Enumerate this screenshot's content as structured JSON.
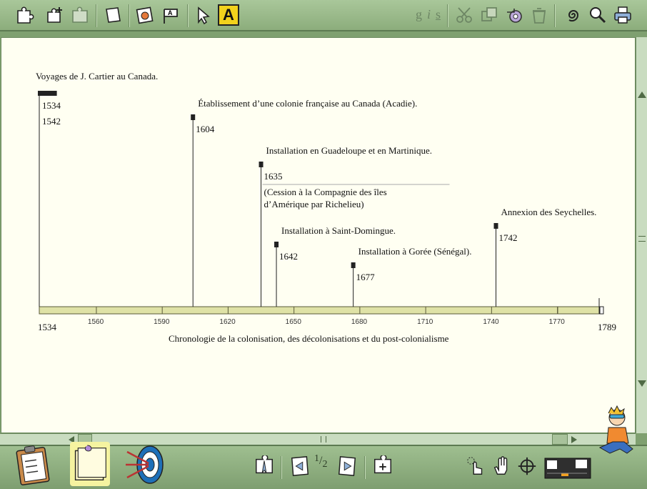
{
  "toolbar_top": {
    "format_buttons": [
      "g",
      "i",
      "s"
    ],
    "text_tool_label": "A",
    "colors": {
      "background": "#9fbf90",
      "active": "#f2d21c"
    }
  },
  "icons": {
    "top": [
      "puzzle-cut-icon",
      "puzzle-add-icon",
      "puzzle-group-icon",
      "page-icon",
      "picture-icon",
      "label-flag-icon",
      "pointer-icon",
      "text-tool-icon",
      "bold-icon",
      "italic-icon",
      "underline-icon",
      "scissors-icon",
      "duplicate-icon",
      "tape-icon",
      "trash-icon",
      "spiral-icon",
      "magnifier-icon",
      "printer-icon"
    ],
    "bottom": [
      "clipboard-checklist-icon",
      "notes-pad-icon",
      "target-arrows-icon",
      "map-pin-icon",
      "previous-page-icon",
      "next-page-icon",
      "add-page-icon",
      "hand-pointer-icon",
      "hand-icon",
      "crosshair-icon",
      "thumbnail-map-icon",
      "kid-mascot-icon"
    ]
  },
  "timeline": {
    "start_label": "1534",
    "end_label": "1789",
    "caption": "Chronologie de la colonisation, des décolonisations et du post-colonialisme",
    "axis_start": 1534,
    "axis_end": 1789,
    "ticks": [
      1560,
      1590,
      1620,
      1650,
      1680,
      1710,
      1740,
      1770
    ],
    "events": [
      {
        "label": "Voyages de J. Cartier au Canada.",
        "year": "1534",
        "year_end": "1542",
        "start": 1534,
        "end": 1542
      },
      {
        "label": "Établissement d’une colonie française au Canada (Acadie).",
        "year": "1604",
        "start": 1604
      },
      {
        "label": "Installation en Guadeloupe et en Martinique.",
        "year": "1635",
        "start": 1635,
        "note_line1": "(Cession à la Compagnie des îles",
        "note_line2": "d’Amérique par Richelieu)"
      },
      {
        "label": "Installation à Saint-Domingue.",
        "year": "1642",
        "start": 1642
      },
      {
        "label": "Installation à Gorée (Sénégal).",
        "year": "1677",
        "start": 1677
      },
      {
        "label": "Annexion des Seychelles.",
        "year": "1742",
        "start": 1742
      }
    ]
  },
  "navigation": {
    "page_current": "1",
    "page_total": "2"
  }
}
